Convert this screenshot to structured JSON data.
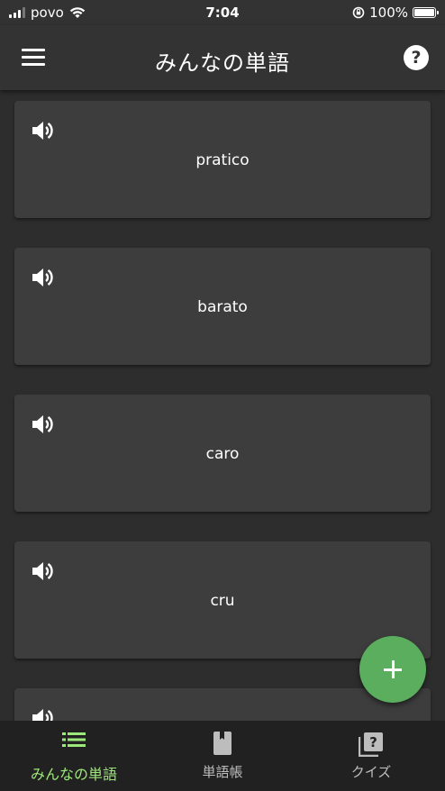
{
  "status_bar": {
    "carrier": "povo",
    "time": "7:04",
    "battery": "100%",
    "battery_level": 1.0
  },
  "app_bar": {
    "title": "みんなの単語",
    "menu_icon": "hamburger-menu-icon",
    "help_icon": "help-icon",
    "help_glyph": "?"
  },
  "words": [
    {
      "text": "pratico",
      "icon": "speaker-icon"
    },
    {
      "text": "barato",
      "icon": "speaker-icon"
    },
    {
      "text": "caro",
      "icon": "speaker-icon"
    },
    {
      "text": "cru",
      "icon": "speaker-icon"
    },
    {
      "text": "",
      "icon": "speaker-icon"
    }
  ],
  "fab": {
    "icon": "plus-icon"
  },
  "bottom_nav": {
    "items": [
      {
        "label": "みんなの単語",
        "icon": "list-icon",
        "active": true
      },
      {
        "label": "単語帳",
        "icon": "book-icon",
        "active": false
      },
      {
        "label": "クイズ",
        "icon": "quiz-icon",
        "active": false
      }
    ]
  },
  "colors": {
    "accent_green": "#5aae5e",
    "active_label": "#9ee77a",
    "card": "#3d3d3d",
    "background": "#2d2d2d",
    "app_bar": "#333333",
    "bottom_nav": "#212121"
  }
}
